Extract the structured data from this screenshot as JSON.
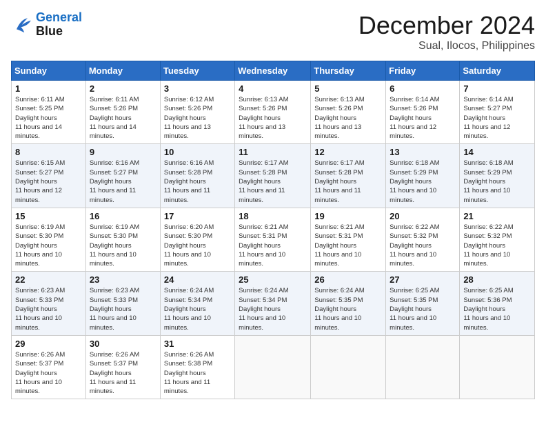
{
  "header": {
    "logo_line1": "General",
    "logo_line2": "Blue",
    "month": "December 2024",
    "location": "Sual, Ilocos, Philippines"
  },
  "weekdays": [
    "Sunday",
    "Monday",
    "Tuesday",
    "Wednesday",
    "Thursday",
    "Friday",
    "Saturday"
  ],
  "weeks": [
    [
      {
        "day": "1",
        "sunrise": "6:11 AM",
        "sunset": "5:25 PM",
        "daylight": "11 hours and 14 minutes."
      },
      {
        "day": "2",
        "sunrise": "6:11 AM",
        "sunset": "5:26 PM",
        "daylight": "11 hours and 14 minutes."
      },
      {
        "day": "3",
        "sunrise": "6:12 AM",
        "sunset": "5:26 PM",
        "daylight": "11 hours and 13 minutes."
      },
      {
        "day": "4",
        "sunrise": "6:13 AM",
        "sunset": "5:26 PM",
        "daylight": "11 hours and 13 minutes."
      },
      {
        "day": "5",
        "sunrise": "6:13 AM",
        "sunset": "5:26 PM",
        "daylight": "11 hours and 13 minutes."
      },
      {
        "day": "6",
        "sunrise": "6:14 AM",
        "sunset": "5:26 PM",
        "daylight": "11 hours and 12 minutes."
      },
      {
        "day": "7",
        "sunrise": "6:14 AM",
        "sunset": "5:27 PM",
        "daylight": "11 hours and 12 minutes."
      }
    ],
    [
      {
        "day": "8",
        "sunrise": "6:15 AM",
        "sunset": "5:27 PM",
        "daylight": "11 hours and 12 minutes."
      },
      {
        "day": "9",
        "sunrise": "6:16 AM",
        "sunset": "5:27 PM",
        "daylight": "11 hours and 11 minutes."
      },
      {
        "day": "10",
        "sunrise": "6:16 AM",
        "sunset": "5:28 PM",
        "daylight": "11 hours and 11 minutes."
      },
      {
        "day": "11",
        "sunrise": "6:17 AM",
        "sunset": "5:28 PM",
        "daylight": "11 hours and 11 minutes."
      },
      {
        "day": "12",
        "sunrise": "6:17 AM",
        "sunset": "5:28 PM",
        "daylight": "11 hours and 11 minutes."
      },
      {
        "day": "13",
        "sunrise": "6:18 AM",
        "sunset": "5:29 PM",
        "daylight": "11 hours and 10 minutes."
      },
      {
        "day": "14",
        "sunrise": "6:18 AM",
        "sunset": "5:29 PM",
        "daylight": "11 hours and 10 minutes."
      }
    ],
    [
      {
        "day": "15",
        "sunrise": "6:19 AM",
        "sunset": "5:30 PM",
        "daylight": "11 hours and 10 minutes."
      },
      {
        "day": "16",
        "sunrise": "6:19 AM",
        "sunset": "5:30 PM",
        "daylight": "11 hours and 10 minutes."
      },
      {
        "day": "17",
        "sunrise": "6:20 AM",
        "sunset": "5:30 PM",
        "daylight": "11 hours and 10 minutes."
      },
      {
        "day": "18",
        "sunrise": "6:21 AM",
        "sunset": "5:31 PM",
        "daylight": "11 hours and 10 minutes."
      },
      {
        "day": "19",
        "sunrise": "6:21 AM",
        "sunset": "5:31 PM",
        "daylight": "11 hours and 10 minutes."
      },
      {
        "day": "20",
        "sunrise": "6:22 AM",
        "sunset": "5:32 PM",
        "daylight": "11 hours and 10 minutes."
      },
      {
        "day": "21",
        "sunrise": "6:22 AM",
        "sunset": "5:32 PM",
        "daylight": "11 hours and 10 minutes."
      }
    ],
    [
      {
        "day": "22",
        "sunrise": "6:23 AM",
        "sunset": "5:33 PM",
        "daylight": "11 hours and 10 minutes."
      },
      {
        "day": "23",
        "sunrise": "6:23 AM",
        "sunset": "5:33 PM",
        "daylight": "11 hours and 10 minutes."
      },
      {
        "day": "24",
        "sunrise": "6:24 AM",
        "sunset": "5:34 PM",
        "daylight": "11 hours and 10 minutes."
      },
      {
        "day": "25",
        "sunrise": "6:24 AM",
        "sunset": "5:34 PM",
        "daylight": "11 hours and 10 minutes."
      },
      {
        "day": "26",
        "sunrise": "6:24 AM",
        "sunset": "5:35 PM",
        "daylight": "11 hours and 10 minutes."
      },
      {
        "day": "27",
        "sunrise": "6:25 AM",
        "sunset": "5:35 PM",
        "daylight": "11 hours and 10 minutes."
      },
      {
        "day": "28",
        "sunrise": "6:25 AM",
        "sunset": "5:36 PM",
        "daylight": "11 hours and 10 minutes."
      }
    ],
    [
      {
        "day": "29",
        "sunrise": "6:26 AM",
        "sunset": "5:37 PM",
        "daylight": "11 hours and 10 minutes."
      },
      {
        "day": "30",
        "sunrise": "6:26 AM",
        "sunset": "5:37 PM",
        "daylight": "11 hours and 11 minutes."
      },
      {
        "day": "31",
        "sunrise": "6:26 AM",
        "sunset": "5:38 PM",
        "daylight": "11 hours and 11 minutes."
      },
      null,
      null,
      null,
      null
    ]
  ]
}
